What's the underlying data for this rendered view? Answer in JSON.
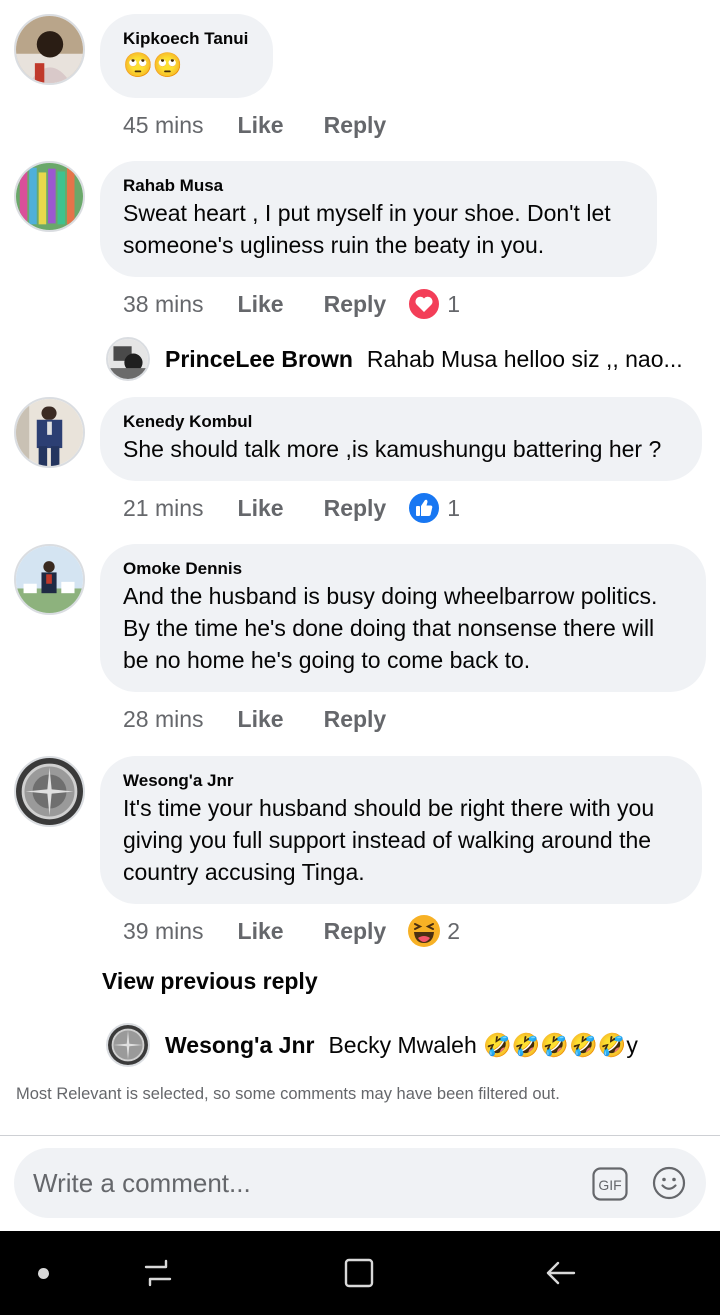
{
  "comments": [
    {
      "name": "Kipkoech Tanui",
      "text": "🙄🙄",
      "time": "45 mins",
      "like": "Like",
      "reply": "Reply"
    },
    {
      "name": "Rahab Musa",
      "text": "Sweat heart , I put myself in your shoe. Don't let\nsomeone's ugliness ruin the beaty in you.",
      "time": "38 mins",
      "like": "Like",
      "reply": "Reply",
      "reaction": {
        "icon": "love-reaction-icon",
        "count": "1"
      }
    },
    {
      "name": "Kenedy Kombul",
      "text": "She should talk more ,is kamushungu battering her ?",
      "time": "21 mins",
      "like": "Like",
      "reply": "Reply",
      "reaction": {
        "icon": "like-reaction-icon",
        "count": "1"
      }
    },
    {
      "name": "Omoke Dennis",
      "text": "And the husband is busy doing wheelbarrow politics.\nBy the time he's done doing that nonsense there will\nbe no home he's going to come back to.",
      "time": "28 mins",
      "like": "Like",
      "reply": "Reply"
    },
    {
      "name": "Wesong'a Jnr",
      "text": "It's time your husband should be right there with you\ngiving you full support instead of walking around the\ncountry accusing Tinga.",
      "time": "39 mins",
      "like": "Like",
      "reply": "Reply",
      "reaction": {
        "icon": "haha-reaction-icon",
        "count": "2"
      }
    }
  ],
  "replies": [
    {
      "name": "PrinceLee Brown",
      "text": "Rahab Musa helloo siz ,, nao..."
    },
    {
      "name": "Wesong'a Jnr",
      "text": "Becky Mwaleh 🤣🤣🤣🤣🤣y"
    }
  ],
  "view_previous": "View previous reply",
  "filter_note": "Most Relevant is selected, so some comments may have been filtered out.",
  "composer": {
    "placeholder": "Write a comment...",
    "gif_label": "GIF"
  },
  "colors": {
    "bubble": "#f0f2f5",
    "meta_text": "#65676b",
    "love": "#f33e58",
    "like": "#1877f2",
    "haha": "#f7b125",
    "navbar": "#000000"
  }
}
